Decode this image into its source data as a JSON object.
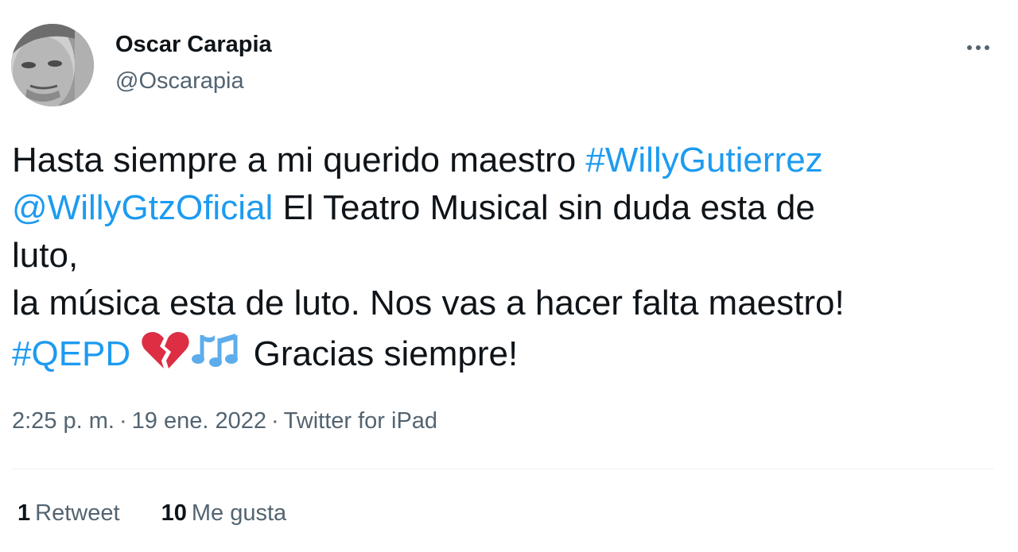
{
  "author": {
    "name": "Oscar Carapia",
    "handle": "@Oscarapia"
  },
  "tweet": {
    "lines": [
      [
        {
          "type": "text",
          "value": "Hasta siempre a mi querido maestro "
        },
        {
          "type": "hashtag",
          "value": "#WillyGutierrez"
        }
      ],
      [
        {
          "type": "mention",
          "value": "@WillyGtzOficial"
        },
        {
          "type": "text",
          "value": " El Teatro Musical sin duda esta de"
        }
      ],
      [
        {
          "type": "text",
          "value": "luto,"
        }
      ],
      [
        {
          "type": "text",
          "value": "la música esta de luto. Nos vas a hacer falta maestro!"
        }
      ],
      [
        {
          "type": "hashtag",
          "value": "#QEPD"
        },
        {
          "type": "text",
          "value": " "
        },
        {
          "type": "emoji",
          "value": "broken-heart-emoji"
        },
        {
          "type": "emoji",
          "value": "musical-notes-emoji"
        },
        {
          "type": "text",
          "value": " Gracias siempre!"
        }
      ]
    ]
  },
  "meta": {
    "time": "2:25 p. m.",
    "separator": "·",
    "date": "19 ene. 2022",
    "source": "Twitter for iPad"
  },
  "stats": {
    "retweets_count": "1",
    "retweets_label": "Retweet",
    "likes_count": "10",
    "likes_label": "Me gusta"
  },
  "colors": {
    "link": "#1d9bf0",
    "text": "#0f1419",
    "secondary": "#536471",
    "divider": "#eff3f4"
  },
  "icons": {
    "more": "more-options-icon",
    "avatar": "profile-photo"
  }
}
